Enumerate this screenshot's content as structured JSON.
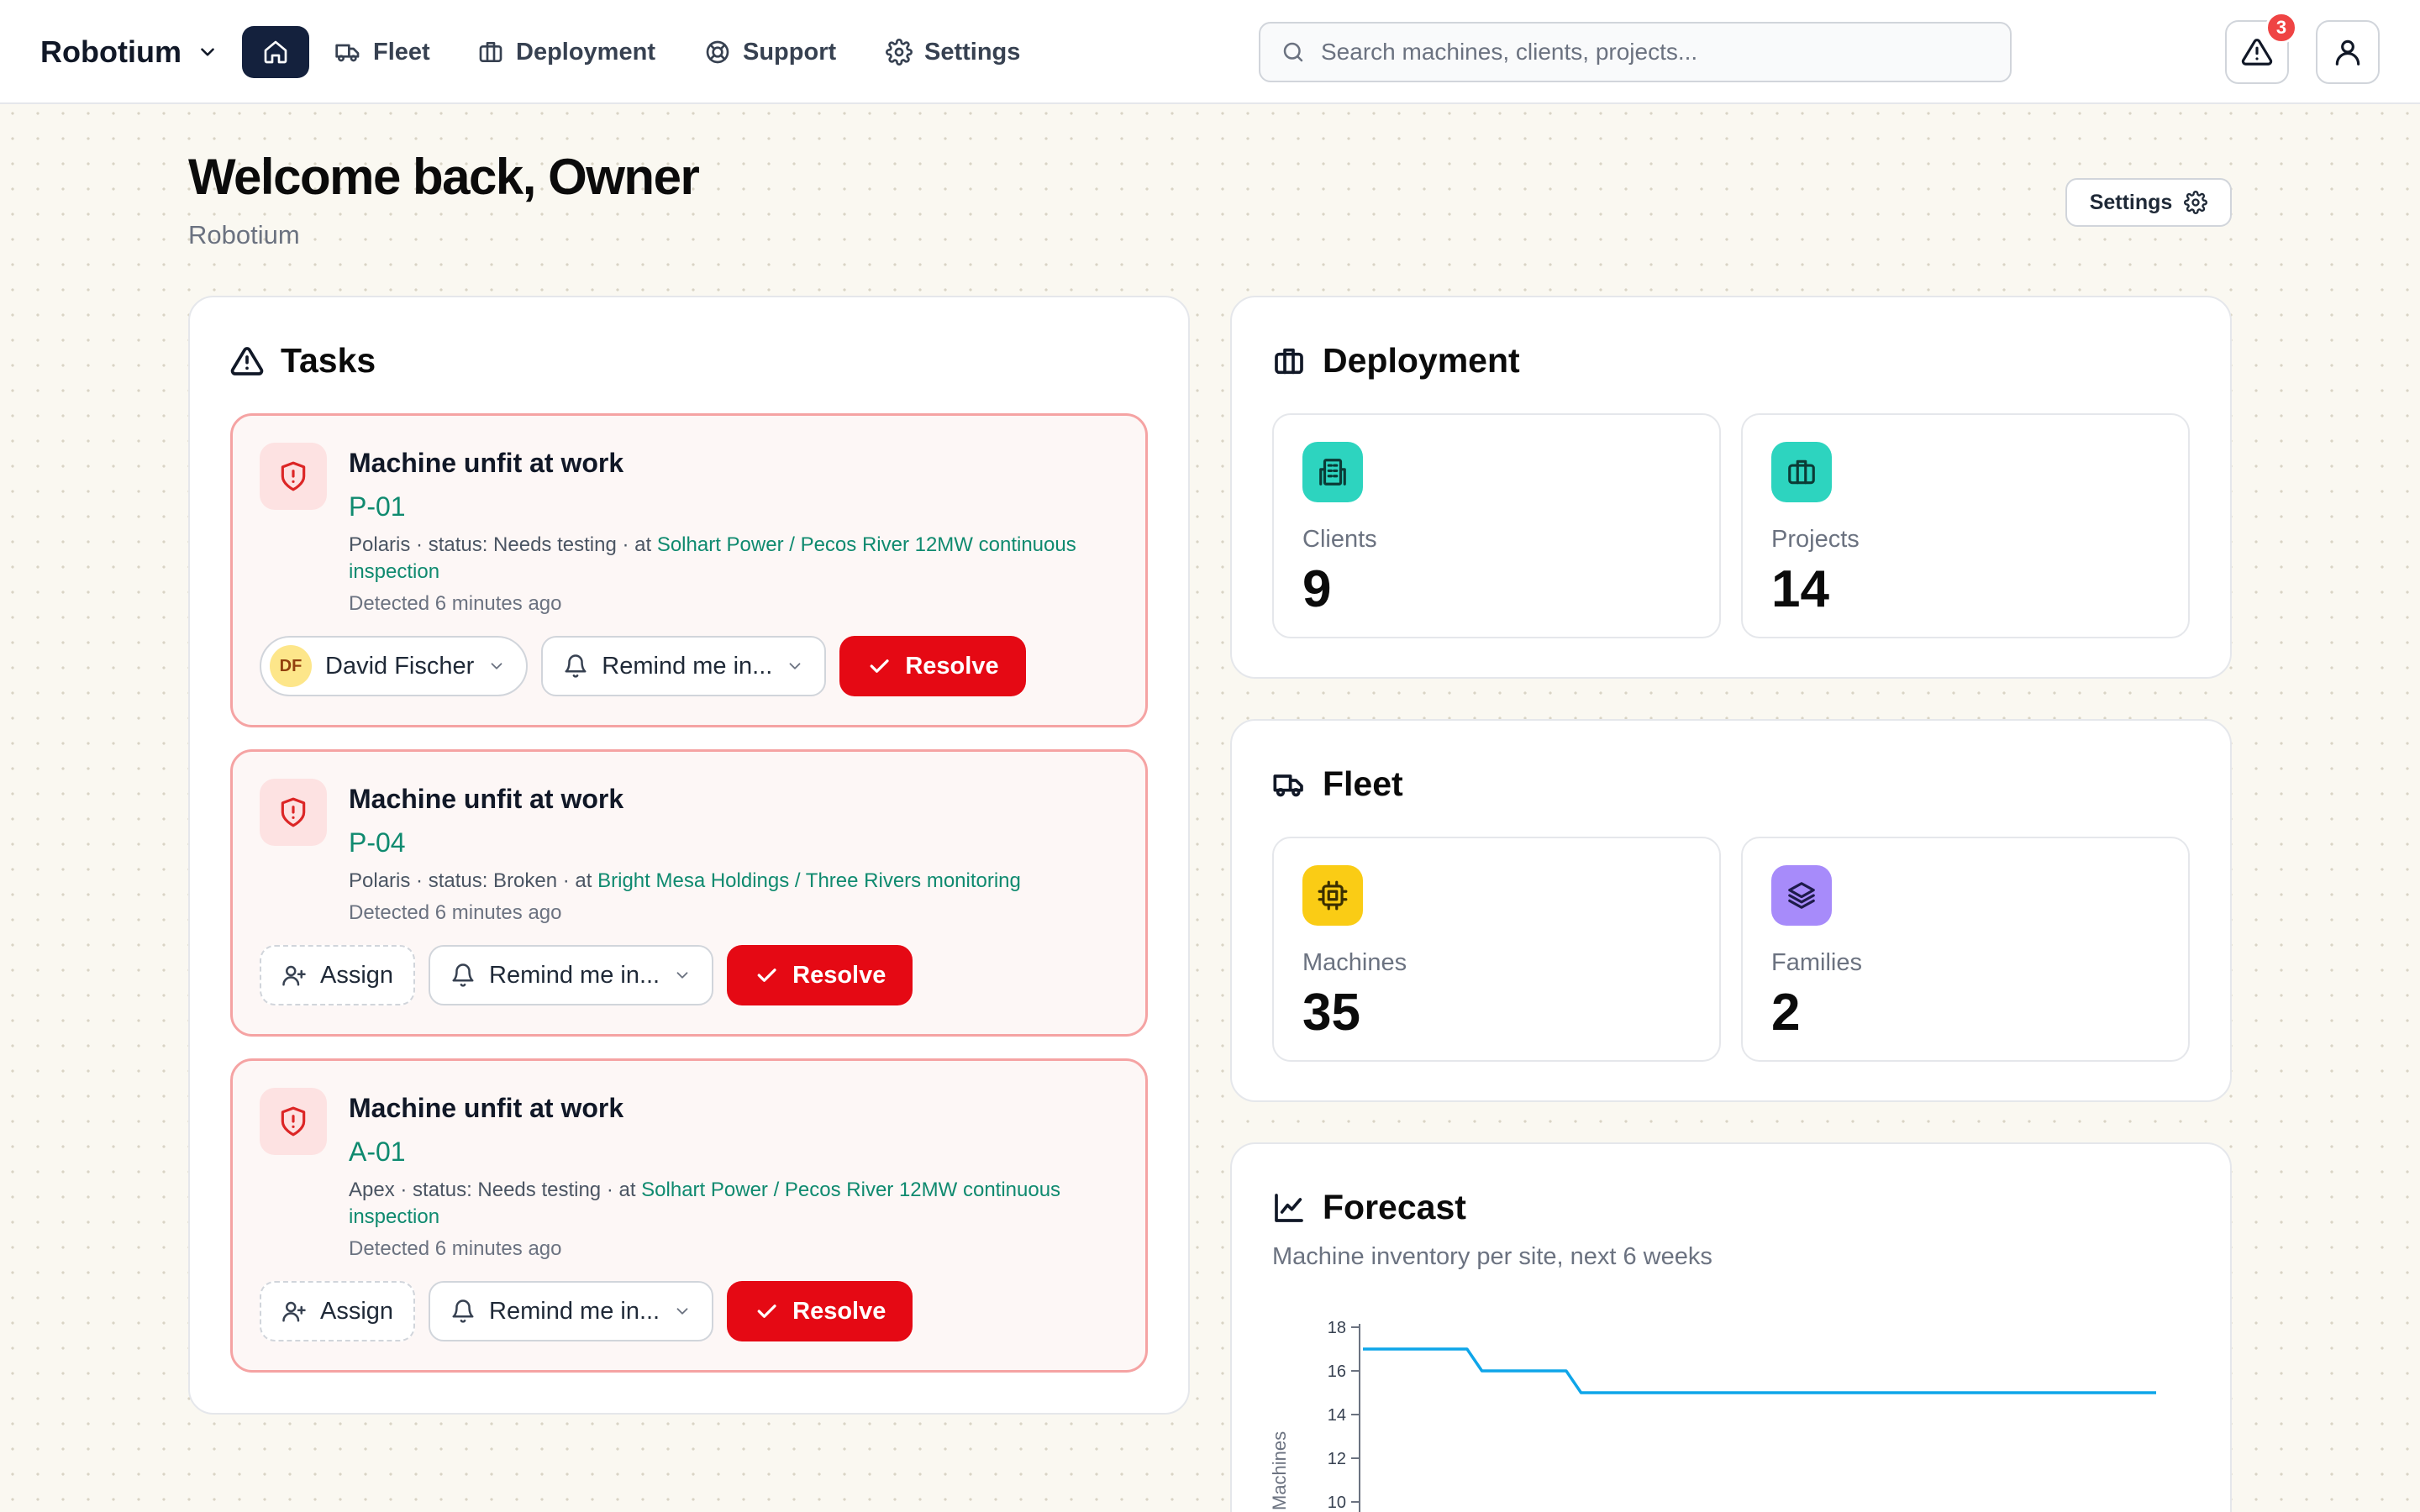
{
  "header": {
    "brand": "Robotium",
    "nav": [
      {
        "label": "Fleet",
        "icon": "truck-icon"
      },
      {
        "label": "Deployment",
        "icon": "briefcase-icon"
      },
      {
        "label": "Support",
        "icon": "lifebuoy-icon"
      },
      {
        "label": "Settings",
        "icon": "gear-icon"
      }
    ],
    "search_placeholder": "Search machines, clients, projects...",
    "alerts_count": "3"
  },
  "page": {
    "title": "Welcome back, Owner",
    "subtitle": "Robotium",
    "settings_label": "Settings"
  },
  "tasks": {
    "title": "Tasks",
    "items": [
      {
        "title": "Machine unfit at work",
        "id": "P-01",
        "meta_prefix": "Polaris · status: Needs testing · at ",
        "location": "Solhart Power / Pecos River 12MW continuous inspection",
        "detected": "Detected 6 minutes ago",
        "assignee_initials": "DF",
        "assignee": "David Fischer",
        "remind_label": "Remind me in...",
        "resolve_label": "Resolve"
      },
      {
        "title": "Machine unfit at work",
        "id": "P-04",
        "meta_prefix": "Polaris · status: Broken · at ",
        "location": "Bright Mesa Holdings / Three Rivers monitoring",
        "detected": "Detected 6 minutes ago",
        "assign_label": "Assign",
        "remind_label": "Remind me in...",
        "resolve_label": "Resolve"
      },
      {
        "title": "Machine unfit at work",
        "id": "A-01",
        "meta_prefix": "Apex · status: Needs testing · at ",
        "location": "Solhart Power / Pecos River 12MW continuous inspection",
        "detected": "Detected 6 minutes ago",
        "assign_label": "Assign",
        "remind_label": "Remind me in...",
        "resolve_label": "Resolve"
      }
    ]
  },
  "deployment": {
    "title": "Deployment",
    "stats": [
      {
        "label": "Clients",
        "value": "9",
        "icon": "building-icon",
        "color": "#2dd4bf"
      },
      {
        "label": "Projects",
        "value": "14",
        "icon": "briefcase-icon",
        "color": "#2dd4bf"
      }
    ]
  },
  "fleet": {
    "title": "Fleet",
    "stats": [
      {
        "label": "Machines",
        "value": "35",
        "icon": "cpu-icon",
        "color": "#facc15"
      },
      {
        "label": "Families",
        "value": "2",
        "icon": "layers-icon",
        "color": "#a78bfa"
      }
    ]
  },
  "forecast": {
    "title": "Forecast",
    "subtitle": "Machine inventory per site, next 6 weeks",
    "chart_data": {
      "type": "line",
      "title": "",
      "ylabel": "Machines",
      "xlabel": "",
      "yticks": [
        18,
        16,
        14,
        12,
        10
      ],
      "ylim": [
        10,
        18
      ],
      "x": [
        0,
        1.05,
        1.2,
        2.05,
        2.2,
        8
      ],
      "series": [
        {
          "values": [
            17,
            17,
            16,
            16,
            15,
            15
          ],
          "color": "#0ea5e9"
        }
      ]
    }
  },
  "colors": {
    "accent_green": "#0f8a6f",
    "danger": "#e50914",
    "nav_active": "#14213d"
  }
}
